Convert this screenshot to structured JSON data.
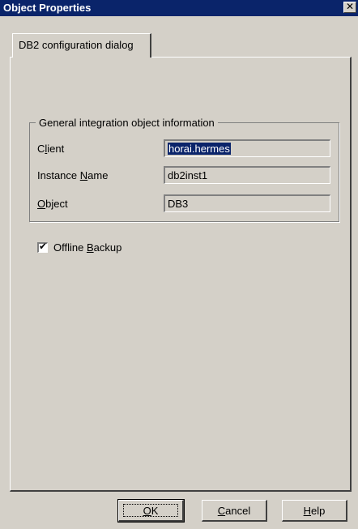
{
  "window": {
    "title": "Object Properties"
  },
  "tabs": [
    {
      "label": "DB2 configuration dialog"
    }
  ],
  "group": {
    "title": "General integration object information",
    "fields": [
      {
        "label_pre": "C",
        "label_key": "l",
        "label_post": "ient",
        "value": "horai.hermes"
      },
      {
        "label_pre": "Instance ",
        "label_key": "N",
        "label_post": "ame",
        "value": "db2inst1"
      },
      {
        "label_pre": "",
        "label_key": "O",
        "label_post": "bject",
        "value": "DB3"
      }
    ]
  },
  "offline_backup": {
    "label_pre": "Offline ",
    "label_key": "B",
    "label_post": "ackup",
    "checked": true
  },
  "buttons": {
    "ok": {
      "key": "O",
      "rest": "K"
    },
    "cancel": {
      "key": "C",
      "rest": "ancel"
    },
    "help": {
      "key": "H",
      "rest": "elp"
    }
  }
}
